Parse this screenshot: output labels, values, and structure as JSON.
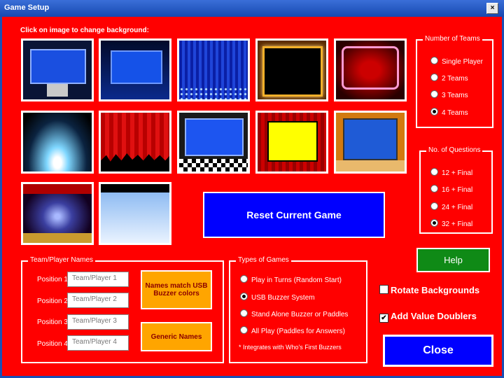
{
  "window": {
    "title": "Game Setup",
    "close_glyph": "×"
  },
  "background_section": {
    "label": "Click on image to change background:"
  },
  "thumbnails": [
    "stage-blue-screen-truss",
    "studio-blue-screen",
    "blue-curtain-sparkles",
    "marquee-lights-frame",
    "neon-frame-red",
    "spotlights-dark",
    "red-curtain-crowd",
    "blue-screen-checker-floor",
    "yellow-screen-curtain",
    "blue-screen-wood-floor",
    "theater-curtain-spotlight",
    "sky-gradient"
  ],
  "teams": {
    "title": "Number of Teams",
    "options": [
      "Single Player",
      "2 Teams",
      "3 Teams",
      "4 Teams"
    ],
    "selected": 3
  },
  "questions": {
    "title": "No. of Questions",
    "options": [
      "12 + Final",
      "16 + Final",
      "24 + Final",
      "32 + Final"
    ],
    "selected": 3
  },
  "reset_button": "Reset Current Game",
  "names": {
    "title": "Team/Player Names",
    "positions": [
      {
        "label": "Position 1",
        "placeholder": "Team/Player 1"
      },
      {
        "label": "Position 2",
        "placeholder": "Team/Player 2"
      },
      {
        "label": "Position 3",
        "placeholder": "Team/Player 3"
      },
      {
        "label": "Position 4",
        "placeholder": "Team/Player 4"
      }
    ],
    "match_button": "Names match USB Buzzer colors",
    "generic_button": "Generic Names"
  },
  "game_types": {
    "title": "Types of Games",
    "options": [
      "Play in Turns (Random Start)",
      "USB Buzzer System",
      "Stand Alone Buzzer or Paddles",
      "All Play (Paddles for Answers)"
    ],
    "selected": 1,
    "note": "* Integrates with Who's First Buzzers"
  },
  "help_button": "Help",
  "rotate": {
    "label": "Rotate Backgrounds",
    "checked": false
  },
  "doublers": {
    "label": "Add Value Doublers",
    "checked": true,
    "check_glyph": "✔"
  },
  "close_button": "Close",
  "colors": {
    "client": "#ff0000",
    "help": "#0f8a16",
    "reset": "#0000ff",
    "orange": "#ffa500"
  }
}
